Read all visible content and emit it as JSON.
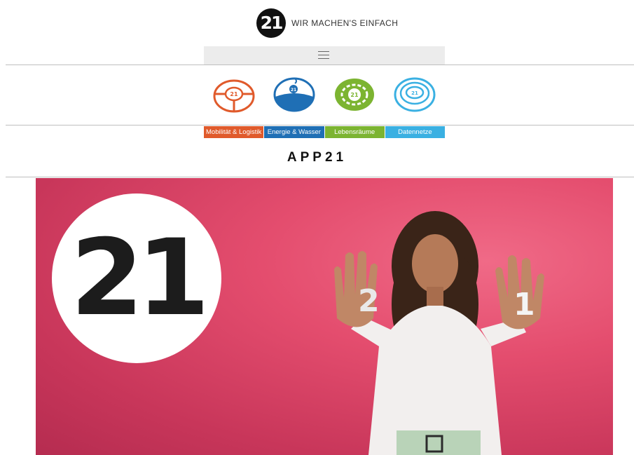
{
  "header": {
    "logo_text": "21",
    "tagline": "WIR MACHEN'S EINFACH"
  },
  "menu": {
    "icon": "hamburger-menu-icon"
  },
  "categories": [
    {
      "label": "Mobilität & Logistik",
      "color": "#e05a2b",
      "icon": "mobility-icon"
    },
    {
      "label": "Energie & Wasser",
      "color": "#1f6fb5",
      "icon": "energy-water-icon"
    },
    {
      "label": "Lebensräume",
      "color": "#7cb431",
      "icon": "living-spaces-icon"
    },
    {
      "label": "Datennetze",
      "color": "#3ab0e2",
      "icon": "data-networks-icon"
    }
  ],
  "page": {
    "title": "APP21"
  },
  "hero": {
    "circle_text": "21"
  }
}
